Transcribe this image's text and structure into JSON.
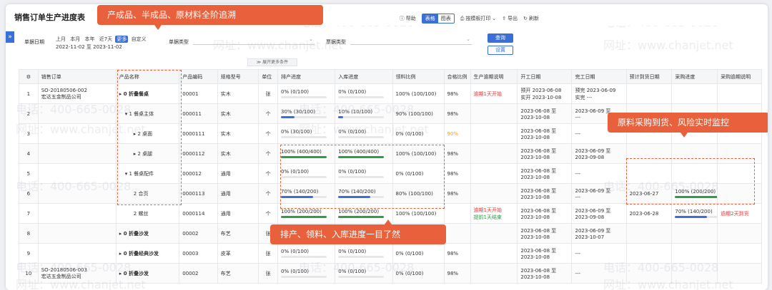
{
  "app": {
    "title": "销售订单生产进度表"
  },
  "toolbar": {
    "help": "帮助",
    "view_table": "表格",
    "view_chart": "图表",
    "print": "按模板打印",
    "export": "导出",
    "refresh": "刷新"
  },
  "filter": {
    "date_label": "单据日期",
    "date_chips": [
      "上月",
      "本月",
      "本年",
      "近7天",
      "更多",
      "自定义"
    ],
    "date_range": "2022-11-02 至 2023-11-02",
    "doc_type_label": "单据类型",
    "bill_type_label": "票据类型",
    "query_label": "查询",
    "settings_label": "设置",
    "expand_label": "展开更多条件"
  },
  "table": {
    "columns": [
      "",
      "销售订单",
      "产品名称",
      "产品编码",
      "规格型号",
      "单位",
      "排产进度",
      "入库进度",
      "领料比例",
      "合格比例",
      "生产逾期说明",
      "开工日期",
      "完工日期",
      "预计到货日期",
      "采购进度",
      "采购逾期说明"
    ],
    "rows": [
      {
        "no": "1",
        "order": "SO-20180506-002",
        "customer": "宏达五金制品公司",
        "name": "▸ 0 折叠餐桌",
        "code": "00001",
        "spec": "实木",
        "unit": "张",
        "plan_pct": 0,
        "plan": "0%",
        "plan_detail": "(0/100)",
        "in_pct": 0,
        "inv": "0%",
        "in_detail": "(0/100)",
        "pick": "100%",
        "pick_detail": "(100/100)",
        "pass": "98%",
        "note1": "逾期1天开始",
        "note2": "",
        "start": "预开 2023-06-08",
        "start2": "实开 2023-10-08",
        "end": "预完 2023-06-09",
        "end2": "实完 ---",
        "eta": "",
        "buy_pct": null,
        "buy": "",
        "buy_note": ""
      },
      {
        "no": "2",
        "order": "",
        "customer": "",
        "name": "▾ 1 餐桌主体",
        "code": "000011",
        "spec": "实木",
        "unit": "个",
        "plan_pct": 30,
        "plan": "30%",
        "plan_detail": "(30/100)",
        "in_pct": 10,
        "inv": "10%",
        "in_detail": "(10/100)",
        "pick": "90%",
        "pick_detail": "(100/100)",
        "pass": "98%",
        "note1": "",
        "note2": "",
        "start": "2023-06-08 至",
        "start2": "2023-10-08",
        "end": "2023-06-09 至",
        "end2": "---",
        "eta": "",
        "buy_pct": null,
        "buy": "",
        "buy_note": ""
      },
      {
        "no": "3",
        "order": "",
        "customer": "",
        "name": "▸ 2 桌面",
        "code": "0000111",
        "spec": "实木",
        "unit": "个",
        "plan_pct": 0,
        "plan": "0%",
        "plan_detail": "(30/100)",
        "in_pct": 0,
        "inv": "0%",
        "in_detail": "(0/100)",
        "pick": "0%",
        "pick_detail": "(0/100)",
        "pass": "90%",
        "note1": "",
        "note2": "",
        "start": "2023-06-08 至",
        "start2": "2023-10-08",
        "end": "---",
        "end2": "",
        "eta": "",
        "buy_pct": null,
        "buy": "",
        "buy_note": ""
      },
      {
        "no": "4",
        "order": "",
        "customer": "",
        "name": "▸ 2 桌腿",
        "code": "0000112",
        "spec": "实木",
        "unit": "个",
        "plan_pct": 100,
        "plan": "100%",
        "plan_detail": "(400/400)",
        "in_pct": 100,
        "inv": "100%",
        "in_detail": "(400/400)",
        "pick": "100%",
        "pick_detail": "(100/100)",
        "pass": "98%",
        "note1": "",
        "note2": "",
        "start": "2023-06-08 至",
        "start2": "2023-10-08",
        "end": "2023-06-09 至",
        "end2": "2023-09-08",
        "eta": "",
        "buy_pct": null,
        "buy": "",
        "buy_note": ""
      },
      {
        "no": "5",
        "order": "",
        "customer": "",
        "name": "▾ 1 餐桌配件",
        "code": "000012",
        "spec": "通用",
        "unit": "个",
        "plan_pct": 0,
        "plan": "0%",
        "plan_detail": "(0/100)",
        "in_pct": 0,
        "inv": "0%",
        "in_detail": "(0/100)",
        "pick": "0%",
        "pick_detail": "(0/100)",
        "pass": "98%",
        "note1": "",
        "note2": "",
        "start": "2023-06-08 至",
        "start2": "2023-10-08",
        "end": "---",
        "end2": "",
        "eta": "",
        "buy_pct": null,
        "buy": "",
        "buy_note": ""
      },
      {
        "no": "6",
        "order": "",
        "customer": "",
        "name": "2 合页",
        "code": "0000113",
        "spec": "通用",
        "unit": "个",
        "plan_pct": 70,
        "plan": "70%",
        "plan_detail": "(140/200)",
        "in_pct": 70,
        "inv": "70%",
        "in_detail": "(140/200)",
        "pick": "80%",
        "pick_detail": "(100/100)",
        "pass": "98%",
        "note1": "",
        "note2": "",
        "start": "2023-06-08 至",
        "start2": "2023-10-08",
        "end": "2023-06-09 至",
        "end2": "---",
        "eta": "2023-06-27",
        "buy_pct": 100,
        "buy": "100%",
        "buy_detail": "(200/200)",
        "buy_note": ""
      },
      {
        "no": "7",
        "order": "",
        "customer": "",
        "name": "2 螺丝",
        "code": "0000114",
        "spec": "通用",
        "unit": "个",
        "plan_pct": 100,
        "plan": "100%",
        "plan_detail": "(200/200)",
        "in_pct": 100,
        "inv": "100%",
        "in_detail": "(200/200)",
        "pick": "100%",
        "pick_detail": "(100/100)",
        "pass": "",
        "note1": "逾期1天开始",
        "note2": "提前1天结束",
        "start": "2023-06-08 至",
        "start2": "2023-10-08",
        "end": "2023-06-09 至",
        "end2": "2023-09-08",
        "eta": "2023-06-28",
        "buy_pct": 70,
        "buy": "70%",
        "buy_detail": "(140/200)",
        "buy_note": "逾期2天到货"
      },
      {
        "no": "8",
        "order": "",
        "customer": "",
        "name": "▸ 0 折叠沙发",
        "code": "00002",
        "spec": "布艺",
        "unit": "张",
        "plan_pct": 0,
        "plan": "",
        "plan_detail": "",
        "in_pct": 0,
        "inv": "",
        "in_detail": "",
        "pick": "",
        "pick_detail": "",
        "pass": "",
        "note1": "",
        "note2": "",
        "start": "2023-06-08 至",
        "start2": "2023-10-08",
        "end": "2023-06-09 至",
        "end2": "2023-10-07",
        "eta": "",
        "buy_pct": null,
        "buy": "",
        "buy_note": ""
      },
      {
        "no": "9",
        "order": "",
        "customer": "",
        "name": "▸ 0 折叠经典沙发",
        "code": "00003",
        "spec": "皮革",
        "unit": "张",
        "plan_pct": 0,
        "plan": "0%",
        "plan_detail": "(0/100)",
        "in_pct": 0,
        "inv": "0%",
        "in_detail": "(0/100)",
        "pick": "0%",
        "pick_detail": "(0/100)",
        "pass": "98%",
        "note1": "",
        "note2": "",
        "start": "2023-06-08 至",
        "start2": "2023-10-08",
        "end": "---",
        "end2": "",
        "eta": "",
        "buy_pct": null,
        "buy": "",
        "buy_note": ""
      },
      {
        "no": "10",
        "order": "SO-20180506-003",
        "customer": "宏达五金制品公司",
        "name": "▸ 0 折叠沙发",
        "code": "00002",
        "spec": "布艺",
        "unit": "张",
        "plan_pct": 0,
        "plan": "0%",
        "plan_detail": "(0/100)",
        "in_pct": 0,
        "inv": "0%",
        "in_detail": "(0/100)",
        "pick": "0%",
        "pick_detail": "(0/100)",
        "pass": "98%",
        "note1": "",
        "note2": "",
        "start": "2023-06-08 至",
        "start2": "2023-10-08",
        "end": "---",
        "end2": "",
        "eta": "",
        "buy_pct": null,
        "buy": "",
        "buy_note": ""
      }
    ]
  },
  "callouts": {
    "top": "产成品、半成品、原材料全阶追溯",
    "right": "原料采购到货、风险实时监控",
    "bottom": "排产、领料、入库进度一目了然"
  },
  "watermarks": {
    "phone": "电话：400-665-0028",
    "site": "网址：www.chanjet.net"
  },
  "colors": {
    "accent": "#3a6fd8",
    "callout": "#e8613c",
    "bar_blue": "#3a6fd8",
    "bar_green": "#2e9e44",
    "red": "#e53935"
  }
}
